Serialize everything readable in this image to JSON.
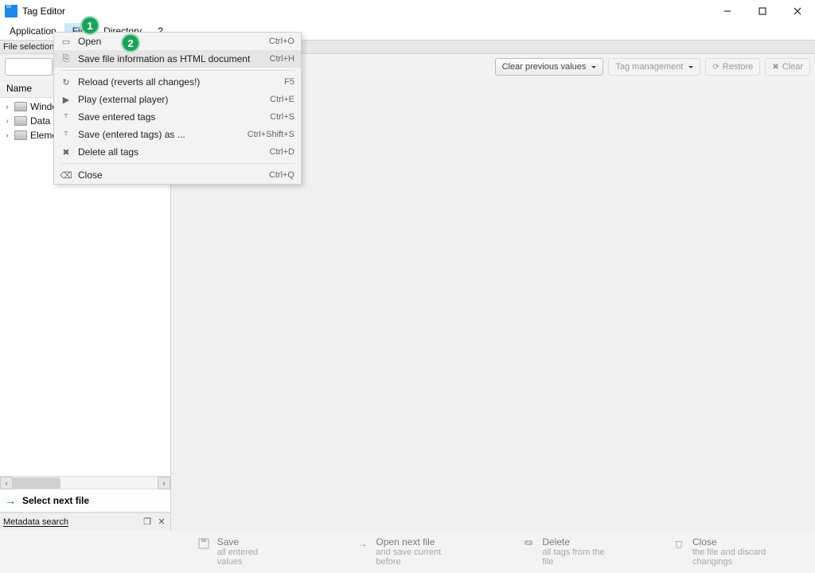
{
  "window": {
    "title": "Tag Editor"
  },
  "menubar": {
    "items": [
      "Application",
      "File",
      "Directory",
      "?"
    ],
    "active_index": 1
  },
  "fileselection_label": "File selection",
  "toolbar": {
    "clear_previous": "Clear previous values",
    "tag_management": "Tag management",
    "restore": "Restore",
    "clear": "Clear"
  },
  "tree": {
    "header": "Name",
    "rows": [
      {
        "label": "Windo"
      },
      {
        "label": "Data ("
      },
      {
        "label": "Eleme"
      }
    ]
  },
  "file_menu": {
    "groups": [
      [
        {
          "icon": "open",
          "label": "Open",
          "shortcut": "Ctrl+O",
          "highlight": false
        },
        {
          "icon": "html",
          "label": "Save file information as HTML document",
          "shortcut": "Ctrl+H",
          "highlight": true
        }
      ],
      [
        {
          "icon": "reload",
          "label": "Reload (reverts all changes!)",
          "shortcut": "F5"
        },
        {
          "icon": "play",
          "label": "Play (external player)",
          "shortcut": "Ctrl+E"
        },
        {
          "icon": "save",
          "label": "Save entered tags",
          "shortcut": "Ctrl+S"
        },
        {
          "icon": "saveas",
          "label": "Save (entered tags) as ...",
          "shortcut": "Ctrl+Shift+S"
        },
        {
          "icon": "delete",
          "label": "Delete all tags",
          "shortcut": "Ctrl+D"
        }
      ],
      [
        {
          "icon": "close",
          "label": "Close",
          "shortcut": "Ctrl+Q"
        }
      ]
    ]
  },
  "nextfile": {
    "label": "Select next file"
  },
  "metasearch": {
    "label": "Metadata search"
  },
  "bottom": {
    "save": {
      "title": "Save",
      "sub": "all entered values"
    },
    "opennext": {
      "title": "Open next file",
      "sub": "and save current before"
    },
    "delete": {
      "title": "Delete",
      "sub": "all tags from the file"
    },
    "close": {
      "title": "Close",
      "sub": "the file and discard changings"
    }
  },
  "callouts": {
    "one": "1",
    "two": "2"
  }
}
